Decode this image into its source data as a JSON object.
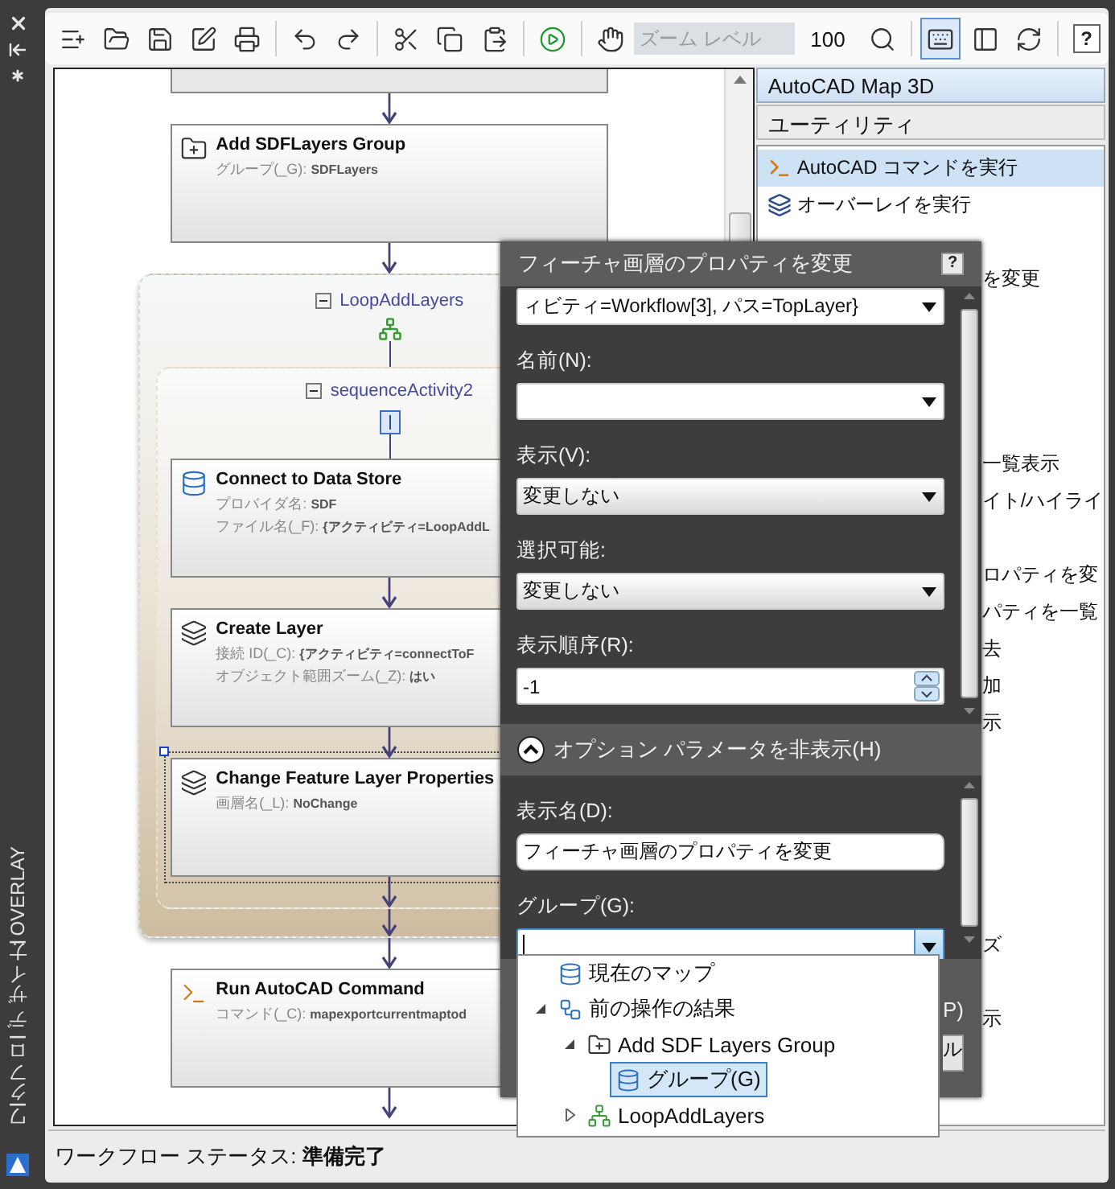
{
  "side_strip": {
    "title": "ワークフロー デザイナー : OVERLAY"
  },
  "toolbar": {
    "groups": [
      [
        {
          "kind": "new",
          "selected": false
        },
        {
          "kind": "open",
          "selected": false
        },
        {
          "kind": "save",
          "selected": false
        },
        {
          "kind": "edit",
          "selected": false
        },
        {
          "kind": "print",
          "selected": false
        }
      ],
      [
        {
          "kind": "undo",
          "selected": false
        },
        {
          "kind": "redo",
          "selected": false
        }
      ],
      [
        {
          "kind": "cut",
          "selected": false
        },
        {
          "kind": "copy",
          "selected": false
        },
        {
          "kind": "paste",
          "selected": false
        }
      ],
      [
        {
          "kind": "run",
          "selected": false
        }
      ],
      [
        {
          "kind": "pan",
          "selected": false
        },
        {
          "kind": "zoom_field",
          "placeholder": "ズーム レベル",
          "disabled": true
        },
        {
          "kind": "percent",
          "label": "100"
        },
        {
          "kind": "zoom_fit",
          "selected": false
        }
      ],
      [
        {
          "kind": "keyboard",
          "selected": true
        },
        {
          "kind": "panel",
          "selected": false
        },
        {
          "kind": "refresh",
          "selected": false
        }
      ],
      [
        {
          "kind": "help",
          "label": "?",
          "selected": false
        }
      ]
    ]
  },
  "workflow": {
    "items": [
      {
        "kind": "stub"
      },
      {
        "kind": "activity",
        "title": "Add SDFLayers Group",
        "selected": false,
        "params": [
          {
            "label": "グループ(_G):",
            "value": "SDFLayers"
          }
        ]
      },
      {
        "kind": "loop",
        "title": "LoopAddLayers",
        "children": [
          {
            "kind": "sequence",
            "title": "sequenceActivity2",
            "children": [
              {
                "kind": "activity",
                "title": "Connect to Data Store",
                "selected": false,
                "params": [
                  {
                    "label": "プロバイダ名:",
                    "value": "SDF"
                  },
                  {
                    "label": "ファイル名(_F):",
                    "value": "{アクティビティ=LoopAddL"
                  }
                ]
              },
              {
                "kind": "activity",
                "title": "Create Layer",
                "selected": false,
                "params": [
                  {
                    "label": "接続 ID(_C):",
                    "value": "{アクティビティ=connectToF"
                  },
                  {
                    "label": "オブジェクト範囲ズーム(_Z):",
                    "value": "はい"
                  }
                ]
              },
              {
                "kind": "activity",
                "title": "Change Feature Layer Properties",
                "selected": true,
                "params": [
                  {
                    "label": "画層名(_L):",
                    "value": "NoChange"
                  }
                ]
              }
            ]
          }
        ]
      },
      {
        "kind": "activity",
        "title": "Run AutoCAD Command",
        "selected": false,
        "params": [
          {
            "label": "コマンド(_C):",
            "value": "mapexportcurrentmaptod"
          }
        ]
      }
    ]
  },
  "palette": {
    "title": "AutoCAD Map 3D",
    "category": "ユーティリティ",
    "items": [
      {
        "kind": "full",
        "label": "AutoCAD コマンドを実行",
        "selected": true
      },
      {
        "kind": "full",
        "label": "オーバーレイを実行",
        "selected": false
      },
      {
        "kind": "covered"
      },
      {
        "kind": "fragment",
        "label": "を変更"
      },
      {
        "kind": "covered"
      },
      {
        "kind": "covered"
      },
      {
        "kind": "covered"
      },
      {
        "kind": "covered"
      },
      {
        "kind": "fragment",
        "label": "一覧表示"
      },
      {
        "kind": "fragment",
        "label": "イト/ハイライ"
      },
      {
        "kind": "covered"
      },
      {
        "kind": "fragment",
        "label": "ロパティを変"
      },
      {
        "kind": "fragment",
        "label": "パティを一覧"
      },
      {
        "kind": "fragment",
        "label": "去"
      },
      {
        "kind": "fragment",
        "label": "加"
      },
      {
        "kind": "fragment",
        "label": "示"
      },
      {
        "kind": "covered"
      },
      {
        "kind": "covered"
      },
      {
        "kind": "covered"
      },
      {
        "kind": "covered"
      },
      {
        "kind": "covered"
      },
      {
        "kind": "fragment",
        "label": "ズ"
      },
      {
        "kind": "covered"
      },
      {
        "kind": "fragment",
        "label": "示"
      }
    ]
  },
  "dialog": {
    "title": "フィーチャ画層のプロパティを変更",
    "help": "?",
    "fields": [
      {
        "kind": "combo",
        "value": "ィビティ=Workflow[3], パス=TopLayer}"
      },
      {
        "kind": "combo",
        "label": "名前(N):"
      },
      {
        "kind": "select",
        "label": "表示(V):",
        "value": "変更しない"
      },
      {
        "kind": "select",
        "label": "選択可能:",
        "value": "変更しない"
      },
      {
        "kind": "spinner",
        "label": "表示順序(R):",
        "value": "-1"
      }
    ],
    "options_toggle": {
      "label": "オプション パラメータを非表示(H)",
      "expanded": true
    },
    "optional_fields": [
      {
        "kind": "text",
        "label": "表示名(D):",
        "value": "フィーチャ画層のプロパティを変更"
      },
      {
        "kind": "combo",
        "label": "グループ(G):",
        "focused": true
      }
    ],
    "covered_label": "P)",
    "covered_button": "ル"
  },
  "group_dropdown": {
    "items": [
      {
        "kind": "map",
        "label": "現在のマップ",
        "selected": false
      },
      {
        "kind": "results",
        "label": "前の操作の結果",
        "selected": false,
        "expanded": true,
        "children": [
          {
            "kind": "activity",
            "label": "Add SDF Layers Group",
            "selected": false,
            "expanded": true,
            "children": [
              {
                "kind": "group",
                "label": "グループ(G)",
                "selected": true
              }
            ]
          },
          {
            "kind": "loop",
            "label": "LoopAddLayers",
            "selected": false,
            "expanded": false
          }
        ]
      }
    ]
  },
  "status_bar": {
    "label": "ワークフロー ステータス:",
    "value": "準備完了"
  }
}
